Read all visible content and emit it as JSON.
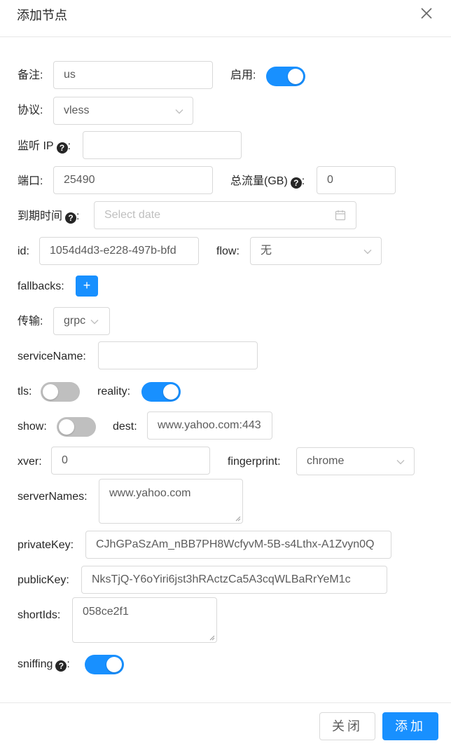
{
  "dialog": {
    "title": "添加节点",
    "close_icon": "close-icon"
  },
  "form": {
    "remark": {
      "label": "备注:",
      "value": "us"
    },
    "enable": {
      "label": "启用:",
      "on": true
    },
    "protocol": {
      "label": "协议:",
      "value": "vless"
    },
    "listen_ip": {
      "label": "监听 IP",
      "colon": ":",
      "value": ""
    },
    "port": {
      "label": "端口:",
      "value": "25490"
    },
    "total_traffic": {
      "label": "总流量(GB)",
      "colon": ":",
      "value": "0"
    },
    "expiry": {
      "label": "到期时间",
      "colon": ":",
      "placeholder": "Select date",
      "icon": "calendar-icon"
    },
    "id": {
      "label": "id:",
      "value": "1054d4d3-e228-497b-bfd"
    },
    "flow": {
      "label": "flow:",
      "value": "无"
    },
    "fallbacks": {
      "label": "fallbacks:",
      "add_label": "+"
    },
    "transport": {
      "label": "传输:",
      "value": "grpc"
    },
    "service_name": {
      "label": "serviceName:",
      "value": ""
    },
    "tls": {
      "label": "tls:",
      "on": false
    },
    "reality": {
      "label": "reality:",
      "on": true
    },
    "show": {
      "label": "show:",
      "on": false
    },
    "dest": {
      "label": "dest:",
      "value": "www.yahoo.com:443"
    },
    "xver": {
      "label": "xver:",
      "value": "0"
    },
    "fingerprint": {
      "label": "fingerprint:",
      "value": "chrome"
    },
    "server_names": {
      "label": "serverNames:",
      "value": "www.yahoo.com"
    },
    "private_key": {
      "label": "privateKey:",
      "value": "CJhGPaSzAm_nBB7PH8WcfyvM-5B-s4Lthx-A1Zvyn0Q"
    },
    "public_key": {
      "label": "publicKey:",
      "value": "NksTjQ-Y6oYiri6jst3hRActzCa5A3cqWLBaRrYeM1c"
    },
    "short_ids": {
      "label": "shortIds:",
      "value": "058ce2f1"
    },
    "sniffing": {
      "label": "sniffing",
      "colon": ":",
      "on": true
    }
  },
  "help_glyph": "?",
  "footer": {
    "close_label": "关闭",
    "add_label": "添加"
  },
  "colors": {
    "primary": "#1890ff",
    "switch_off": "#bfbfbf"
  }
}
